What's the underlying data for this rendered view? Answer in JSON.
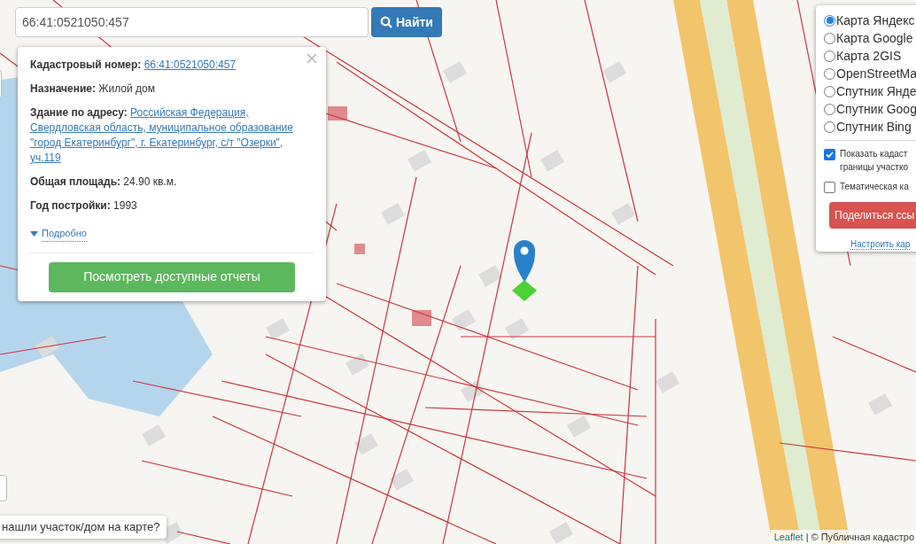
{
  "search": {
    "value": "66:41:0521050:457",
    "button": "Найти"
  },
  "popup": {
    "fields": [
      {
        "label": "Кадастровый номер:",
        "value": "66:41:0521050:457",
        "kind": "link"
      },
      {
        "label": "Назначение:",
        "value": "Жилой дом",
        "kind": "text"
      },
      {
        "label": "Здание по адресу:",
        "lines": [
          "Российская Федерация,",
          "Свердловская область, муниципальное образование",
          "\"город Екатеринбург\", г. Екатеринбург, с/т \"Озерки\",",
          "уч.119"
        ],
        "kind": "address"
      },
      {
        "label": "Общая площадь:",
        "value": "24.90 кв.м.",
        "kind": "text"
      },
      {
        "label": "Год постройки:",
        "value": "1993",
        "kind": "text"
      }
    ],
    "more": {
      "label": "Подробно",
      "expanded": false
    },
    "action": "Посмотреть доступные отчеты"
  },
  "layers": {
    "base": [
      {
        "label": "Карта Яндекс",
        "selected": true
      },
      {
        "label": "Карта Google",
        "selected": false
      },
      {
        "label": "Карта 2GIS",
        "selected": false
      },
      {
        "label": "OpenStreetMa",
        "selected": false
      },
      {
        "label": "Спутник Янде",
        "selected": false
      },
      {
        "label": "Спутник Goog",
        "selected": false
      },
      {
        "label": "Спутник Bing",
        "selected": false
      }
    ],
    "overlays": [
      {
        "lines": [
          "Показать кадаст",
          "границы участко"
        ],
        "checked": true
      },
      {
        "lines": [
          "Тематическая ка"
        ],
        "checked": false
      }
    ],
    "share": "Поделиться ссы",
    "settings": "Настроить кар"
  },
  "feedback": "нашли участок/дом на карте?",
  "attribution": {
    "link": "Leaflet",
    "separator": "|",
    "text": "© Публичная кадастро"
  }
}
